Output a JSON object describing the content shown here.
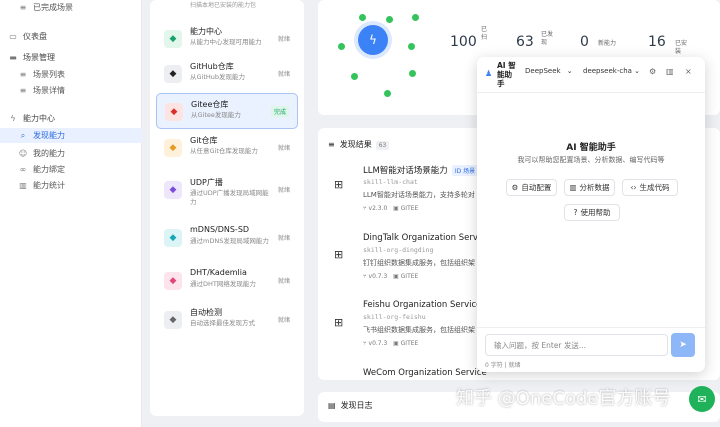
{
  "sidebar": {
    "items": [
      {
        "label": "已完成场景",
        "icon": "list-icon",
        "level": "sub"
      },
      {
        "label": "仪表盘",
        "icon": "monitor-icon",
        "level": "top"
      },
      {
        "label": "场景管理",
        "icon": "folder-icon",
        "level": "top"
      },
      {
        "label": "场景列表",
        "icon": "list-icon",
        "level": "sub"
      },
      {
        "label": "场景详情",
        "icon": "list-icon",
        "level": "sub"
      },
      {
        "label": "能力中心",
        "icon": "lightning-icon",
        "level": "top"
      },
      {
        "label": "发现能力",
        "icon": "search-icon",
        "level": "sub",
        "active": true
      },
      {
        "label": "我的能力",
        "icon": "user-icon",
        "level": "sub"
      },
      {
        "label": "能力绑定",
        "icon": "link-icon",
        "level": "sub"
      },
      {
        "label": "能力统计",
        "icon": "bar-chart-icon",
        "level": "sub"
      }
    ]
  },
  "discovery": {
    "top_clip": "扫描本地已安装的能力包",
    "items": [
      {
        "title": "能力中心",
        "desc": "从能力中心发现可用能力",
        "status": "就绪",
        "icon": "cloud-icon",
        "color": "#1aa06a",
        "bg": "#e3f6ec"
      },
      {
        "title": "GitHub仓库",
        "desc": "从GitHub发现能力",
        "status": "就绪",
        "icon": "github-icon",
        "color": "#222222",
        "bg": "#eceef2"
      },
      {
        "title": "Gitee仓库",
        "desc": "从Gitee发现能力",
        "status": "完成",
        "icon": "gitee-icon",
        "color": "#d9302c",
        "bg": "#fde4e3",
        "active": true
      },
      {
        "title": "Git仓库",
        "desc": "从任意Git仓库发现能力",
        "status": "就绪",
        "icon": "git-icon",
        "color": "#e69a1e",
        "bg": "#fdf1dc"
      },
      {
        "title": "UDP广播",
        "desc": "通过UDP广播发现局域网能力",
        "status": "就绪",
        "icon": "broadcast-icon",
        "color": "#7c4ddb",
        "bg": "#eee6fb"
      },
      {
        "title": "mDNS/DNS-SD",
        "desc": "通过mDNS发现局域网能力",
        "status": "就绪",
        "icon": "wifi-icon",
        "color": "#17a6b4",
        "bg": "#ddf4f6"
      },
      {
        "title": "DHT/Kademlia",
        "desc": "通过DHT网络发现能力",
        "status": "就绪",
        "icon": "share-icon",
        "color": "#e0457b",
        "bg": "#fce3ec"
      },
      {
        "title": "自动检测",
        "desc": "自动选择最佳发现方式",
        "status": "就绪",
        "icon": "magic-icon",
        "color": "#666666",
        "bg": "#eceef2"
      }
    ]
  },
  "stats": [
    {
      "value": "100",
      "label": "已\n扫"
    },
    {
      "value": "63",
      "label": "已发\n现"
    },
    {
      "value": "0",
      "label": "新能力"
    },
    {
      "value": "16",
      "label": "已安\n装"
    }
  ],
  "results": {
    "title": "发现结果",
    "count": "63",
    "items": [
      {
        "title": "LLM智能对话场景能力",
        "badge": "ID 场景",
        "code": "skill-llm-chat",
        "desc": "LLM智能对话场景能力，支持多轮对",
        "version": "v2.3.0",
        "source": "GITEE"
      },
      {
        "title": "DingTalk Organization Service",
        "code": "skill-org-dingding",
        "desc": "钉钉组织数据集成服务，包括组织架",
        "version": "v0.7.3",
        "source": "GITEE"
      },
      {
        "title": "Feishu Organization Service",
        "code": "skill-org-feishu",
        "desc": "飞书组织数据集成服务，包括组织架",
        "version": "v0.7.3",
        "source": "GITEE"
      },
      {
        "title": "WeCom Organization Service",
        "code": "",
        "desc": "",
        "version": "",
        "source": ""
      }
    ]
  },
  "log": {
    "title": "发现日志"
  },
  "ai": {
    "title_line1": "AI 智",
    "title_line2": "能助",
    "title_line3": "手",
    "provider": "DeepSeek",
    "model": "deepseek-cha",
    "heading": "AI 智能助手",
    "subtitle": "我可以帮助您配置场景、分析数据、编写代码等",
    "actions": [
      "自动配置",
      "分析数据",
      "生成代码",
      "使用帮助"
    ],
    "input_placeholder": "输入问题，按 Enter 发送...",
    "footer": "0 字符 | 就绪"
  },
  "watermark": "知乎 @OneCode官方账号"
}
